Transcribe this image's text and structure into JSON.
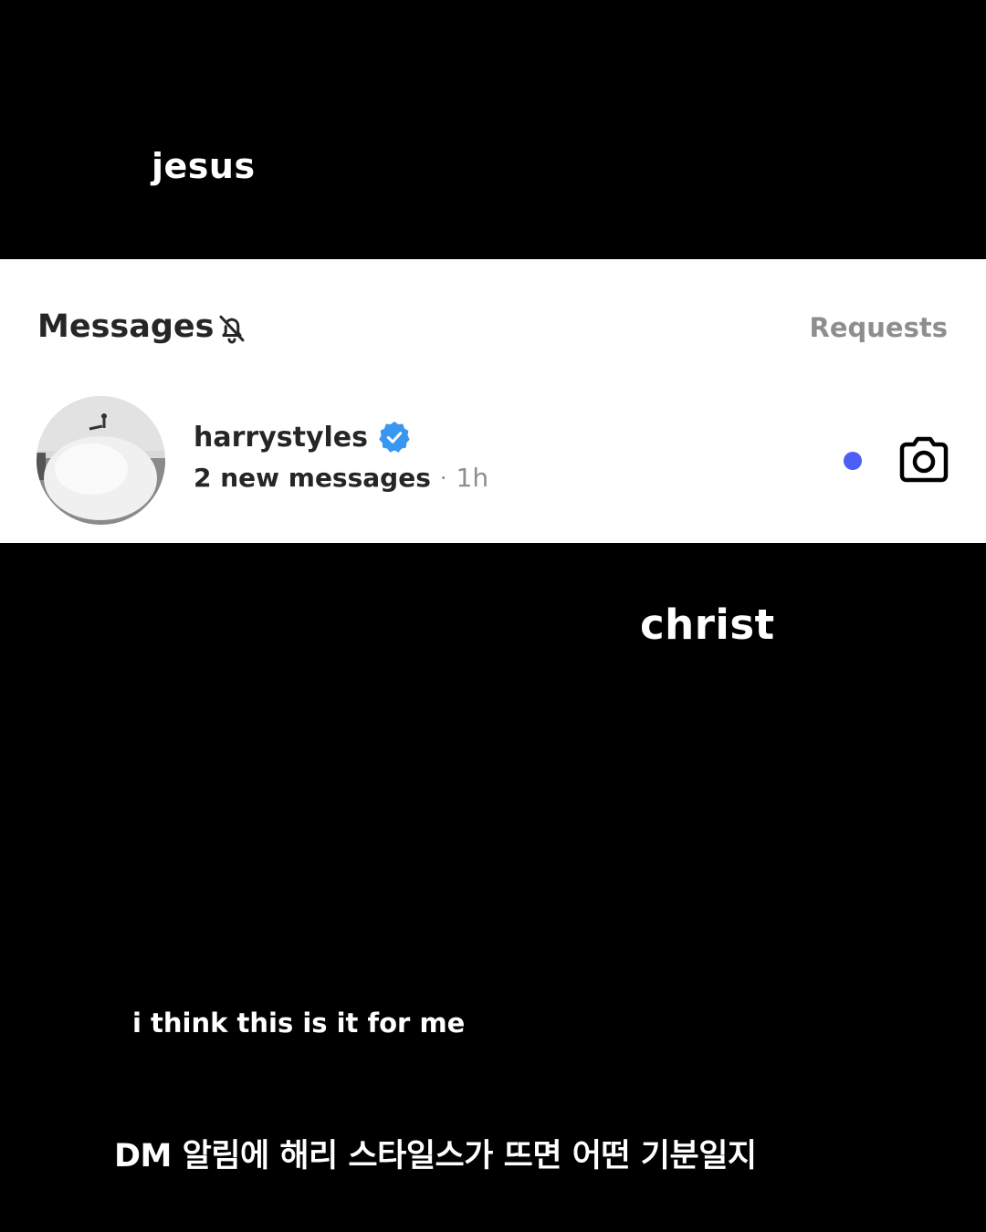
{
  "captions": {
    "top": "jesus",
    "middle": "christ",
    "bottom": "i think this is it for me",
    "korean": "DM 알림에 해리 스타일스가 뜨면 어떤 기분일지"
  },
  "messages_header": {
    "title": "Messages",
    "muted_icon": "bell-off-icon",
    "requests_label": "Requests"
  },
  "thread": {
    "username": "harrystyles",
    "verified_icon": "verified-badge-icon",
    "preview": "2 new messages",
    "separator": "·",
    "time": "1h",
    "unread_icon": "unread-dot-icon",
    "camera_icon": "camera-icon"
  },
  "colors": {
    "background": "#000000",
    "panel": "#ffffff",
    "text_primary": "#262626",
    "text_secondary": "#8e8e8e",
    "verified": "#3897f0",
    "unread": "#4c5ef5"
  }
}
